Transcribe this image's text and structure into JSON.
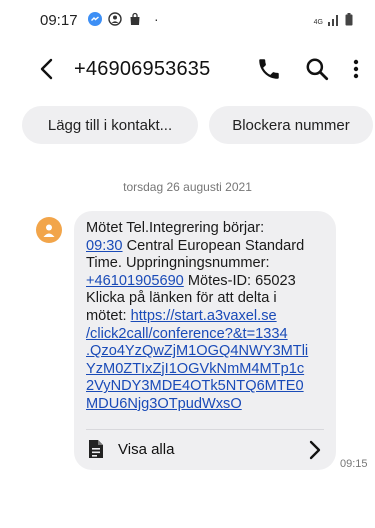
{
  "status_bar": {
    "time": "09:17",
    "dot": "·",
    "network": "4G",
    "icons": [
      "messenger-icon",
      "account-icon",
      "bag-icon",
      "signal-icon",
      "battery-icon"
    ]
  },
  "header": {
    "title": "+46906953635",
    "icons": [
      "back-arrow-icon",
      "phone-icon",
      "search-icon",
      "more-vert-icon"
    ]
  },
  "actions": {
    "add_contact": "Lägg till i kontakt...",
    "block_number": "Blockera nummer"
  },
  "conversation": {
    "date_separator": "torsdag 26 augusti 2021",
    "message": {
      "lines": [
        [
          {
            "t": "Mötet Tel.Integrering börjar:"
          }
        ],
        [
          {
            "t": "09:30",
            "link": true
          },
          {
            "t": " Central European Standard"
          }
        ],
        [
          {
            "t": "Time. Uppringningsnummer:"
          }
        ],
        [
          {
            "t": "+46101905690",
            "link": true
          },
          {
            "t": " Mötes-ID: 65023"
          }
        ],
        [
          {
            "t": "Klicka på länken för att delta i"
          }
        ],
        [
          {
            "t": "mötet: "
          },
          {
            "t": "https://start.a3vaxel.se",
            "link": true
          }
        ],
        [
          {
            "t": "/click2call/conference?&t=1334",
            "link": true
          }
        ],
        [
          {
            "t": ".Qzo4YzQwZjM1OGQ4NWY3MTli",
            "link": true
          }
        ],
        [
          {
            "t": "YzM0ZTIxZjI1OGVkNmM4MTp1c",
            "link": true
          }
        ],
        [
          {
            "t": "2VyNDY3MDE4OTk5NTQ6MTE0",
            "link": true
          }
        ],
        [
          {
            "t": "MDU6Njg3OTpudWxsO",
            "link": true
          }
        ]
      ],
      "view_all": "Visa alla",
      "time": "09:15"
    }
  },
  "colors": {
    "bubble": "#efeff1",
    "link": "#1a4bb8",
    "avatar": "#f2a54a",
    "messenger_blue": "#3d8ff5"
  }
}
